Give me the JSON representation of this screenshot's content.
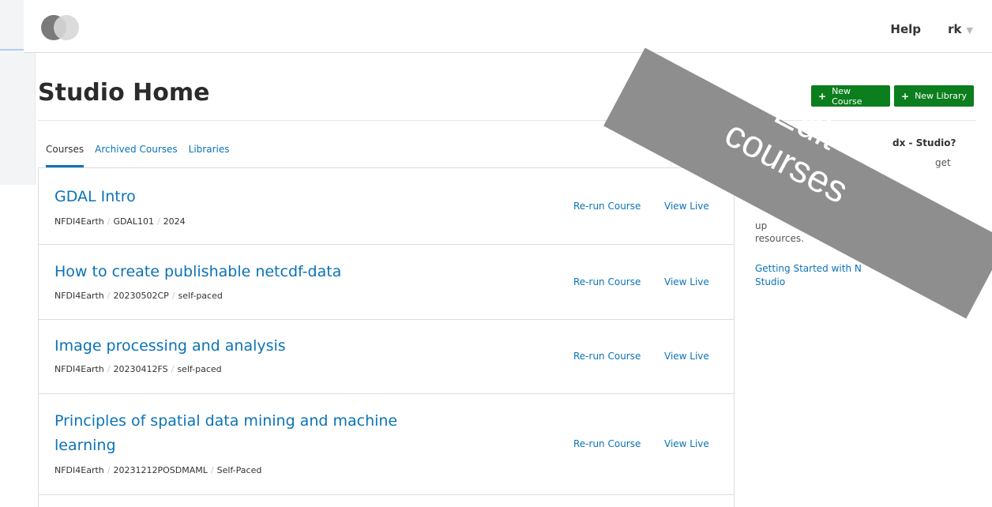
{
  "header": {
    "help": "Help",
    "user": "rk",
    "user_caret": "▼"
  },
  "page": {
    "title": "Studio Home"
  },
  "buttons": {
    "new_course": "New Course",
    "new_library": "New Library",
    "plus": "+"
  },
  "tabs": [
    {
      "label": "Courses",
      "active": true
    },
    {
      "label": "Archived Courses",
      "active": false
    },
    {
      "label": "Libraries",
      "active": false
    }
  ],
  "courses": [
    {
      "title": "GDAL Intro",
      "org": "NFDI4Earth",
      "number": "GDAL101",
      "run": "2024"
    },
    {
      "title": "How to create publishable netcdf-data",
      "org": "NFDI4Earth",
      "number": "20230502CP",
      "run": "self-paced"
    },
    {
      "title": "Image processing and analysis",
      "org": "NFDI4Earth",
      "number": "20230412FS",
      "run": "self-paced"
    },
    {
      "title_line1": "Principles of spatial data mining and machine",
      "title_line2": "learning",
      "org": "NFDI4Earth",
      "number": "20231212POSDMAML",
      "run": "Self-Paced"
    }
  ],
  "actions": {
    "rerun": "Re-run Course",
    "view_live": "View Live",
    "separator": "/"
  },
  "help_panel": {
    "heading": "dx - Studio?",
    "line1": "get",
    "line2": "up",
    "line3": "resources.",
    "link": "Getting Started with N",
    "link_tail": "- Studio"
  },
  "overlay": {
    "line1": "Edit",
    "line2": "courses",
    "color": "#8e8e8e"
  }
}
